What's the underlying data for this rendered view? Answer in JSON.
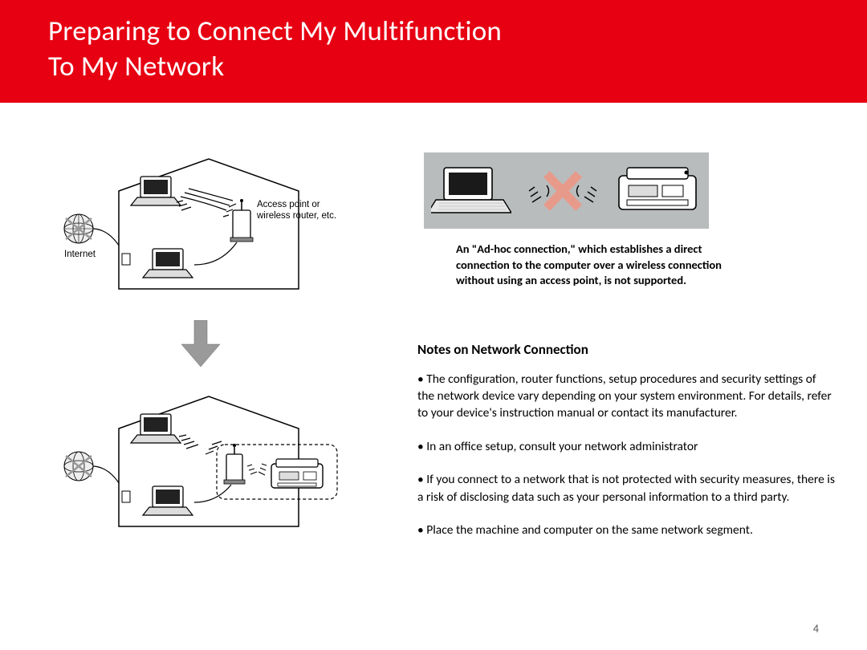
{
  "header": {
    "title_line1": "Preparing to Connect My Multifunction",
    "title_line2": "To My Network"
  },
  "diagram_labels": {
    "internet": "Internet",
    "access_point": "Access point or",
    "access_point2": "wireless router, etc."
  },
  "adhoc": {
    "note": "An \"Ad-hoc connection,\" which establishes a direct connection to the computer over a wireless connection without using an access point, is not supported."
  },
  "notes": {
    "heading": "Notes on Network Connection",
    "bullets": [
      "The configuration, router functions, setup procedures and security settings of the network device vary depending on your system environment. For details, refer to your device's instruction manual or contact its manufacturer.",
      "In an office setup, consult your network administrator",
      "If you connect to a network that is not protected with security measures, there is a risk of disclosing data such as your personal information to a third party.",
      "Place the machine and computer on the same network segment."
    ]
  },
  "page_number": "4"
}
